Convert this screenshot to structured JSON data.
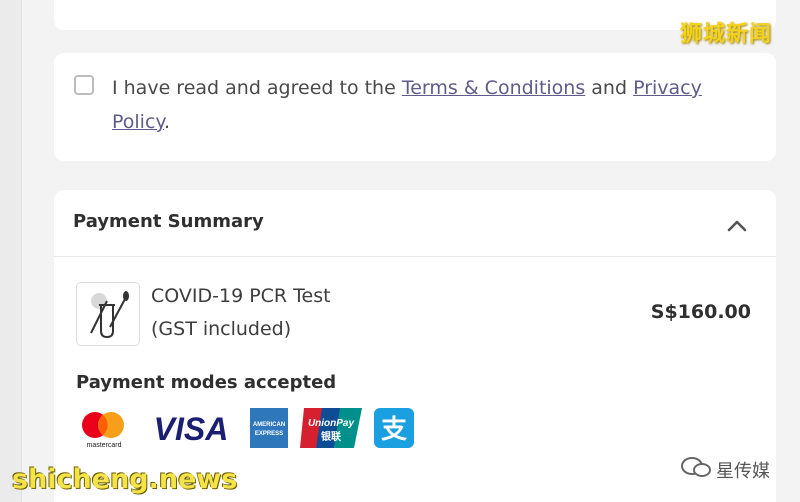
{
  "agreement": {
    "prefix": "I have read and agreed to the ",
    "terms_link": "Terms & Conditions",
    "middle": " and ",
    "privacy_link_line1": "Privacy",
    "privacy_link_line2": "Policy",
    "suffix": "."
  },
  "summary": {
    "title": "Payment Summary",
    "item": {
      "name": "COVID-19 PCR Test",
      "tax_note": "(GST included)",
      "price": "S$160.00"
    },
    "modes_title": "Payment modes accepted",
    "payment_icons": [
      "mastercard-icon",
      "visa-icon",
      "amex-icon",
      "unionpay-icon",
      "alipay-icon"
    ],
    "mastercard_text": "mastercard",
    "visa_text": "VISA",
    "amex_text_1": "AMERICAN",
    "amex_text_2": "EXPRESS",
    "unionpay_text_1": "UnionPay",
    "unionpay_text_2": "银联",
    "alipay_text": "支"
  },
  "watermarks": {
    "top_right": "狮城新闻",
    "bottom_left": "shicheng.news",
    "bottom_right": "星传媒"
  },
  "colors": {
    "link": "#5f5b8a",
    "visa_blue": "#1a1f71",
    "amex_blue": "#2e77bb",
    "unionpay_red": "#d6202f",
    "alipay_blue": "#1a9fe0"
  }
}
